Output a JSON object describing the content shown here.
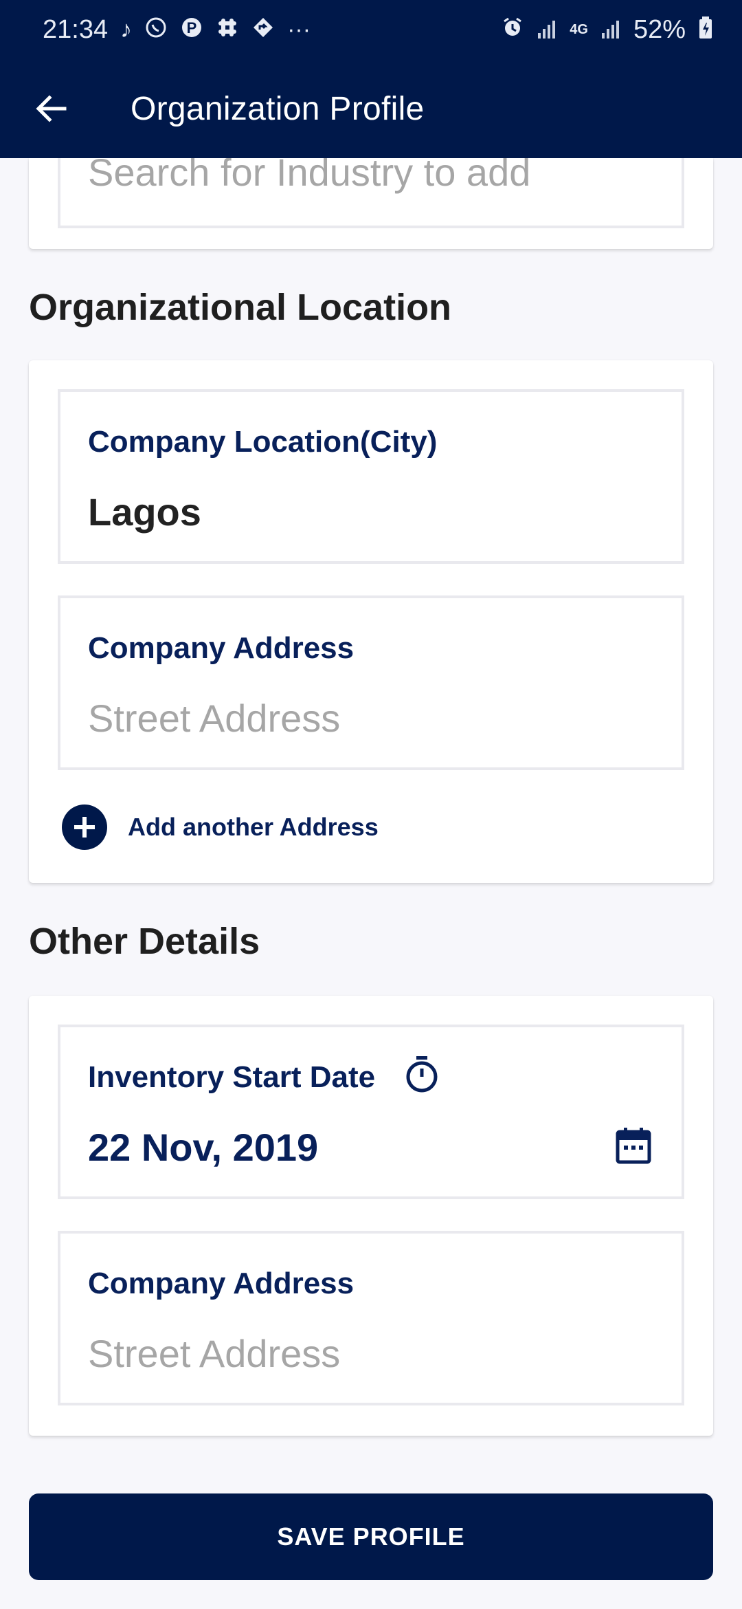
{
  "status_bar": {
    "time": "21:34",
    "more_indicator": "···",
    "network_label": "4G",
    "battery_percent": "52%"
  },
  "app_bar": {
    "title": "Organization Profile"
  },
  "industry": {
    "search_placeholder": "Search for  Industry to add"
  },
  "location_section": {
    "title": "Organizational Location",
    "city_label": "Company Location(City)",
    "city_value": "Lagos",
    "address_label": "Company Address",
    "address_placeholder": "Street Address",
    "add_address_label": "Add another Address"
  },
  "other_section": {
    "title": "Other Details",
    "inventory_label": "Inventory Start Date",
    "inventory_value": "22 Nov, 2019",
    "address_label": "Company Address",
    "address_placeholder": "Street Address"
  },
  "save_button_label": "SAVE PROFILE",
  "colors": {
    "primary": "#00184a",
    "label": "#08205a",
    "placeholder": "#a6a6a6"
  }
}
